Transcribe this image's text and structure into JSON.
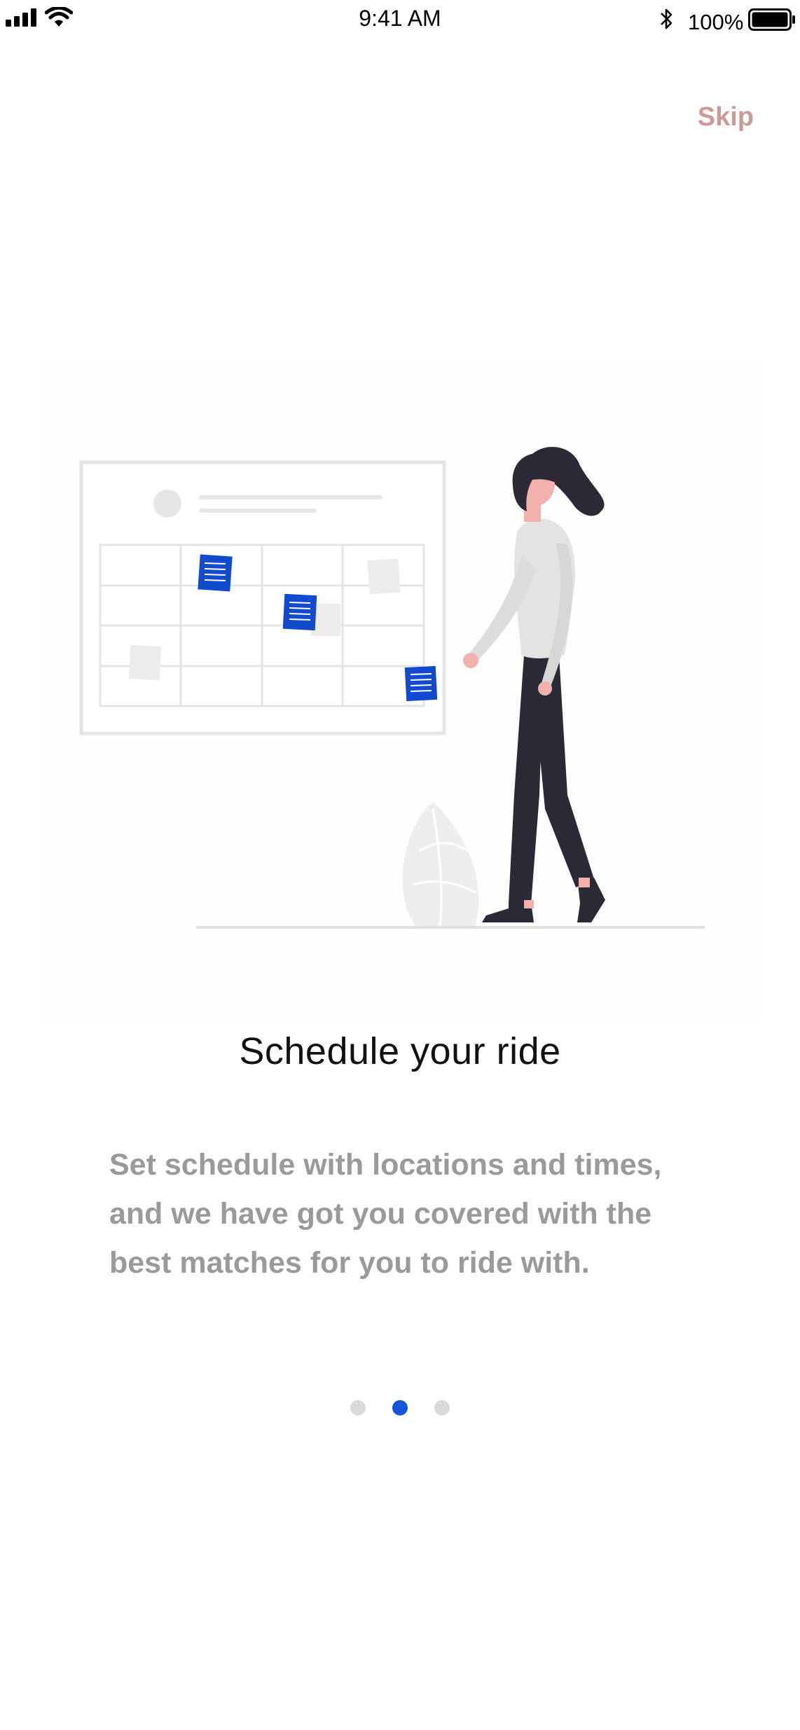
{
  "status_bar": {
    "time": "9:41 AM",
    "battery_percent": "100%",
    "icons": [
      "signal-icon",
      "wifi-icon",
      "bluetooth-icon",
      "battery-icon"
    ]
  },
  "header": {
    "skip_label": "Skip"
  },
  "onboarding": {
    "title": "Schedule your ride",
    "description": "Set schedule with locations and times, and we have got you covered with the best matches for you to ride with.",
    "illustration": "woman-at-calendar-board-illustration",
    "pages_total": 3,
    "current_page": 2
  },
  "colors": {
    "accent": "#1455dc",
    "skip": "#c99a98",
    "title": "#111111",
    "description": "#9a9a9a",
    "dot_inactive": "#d9d9d9"
  }
}
